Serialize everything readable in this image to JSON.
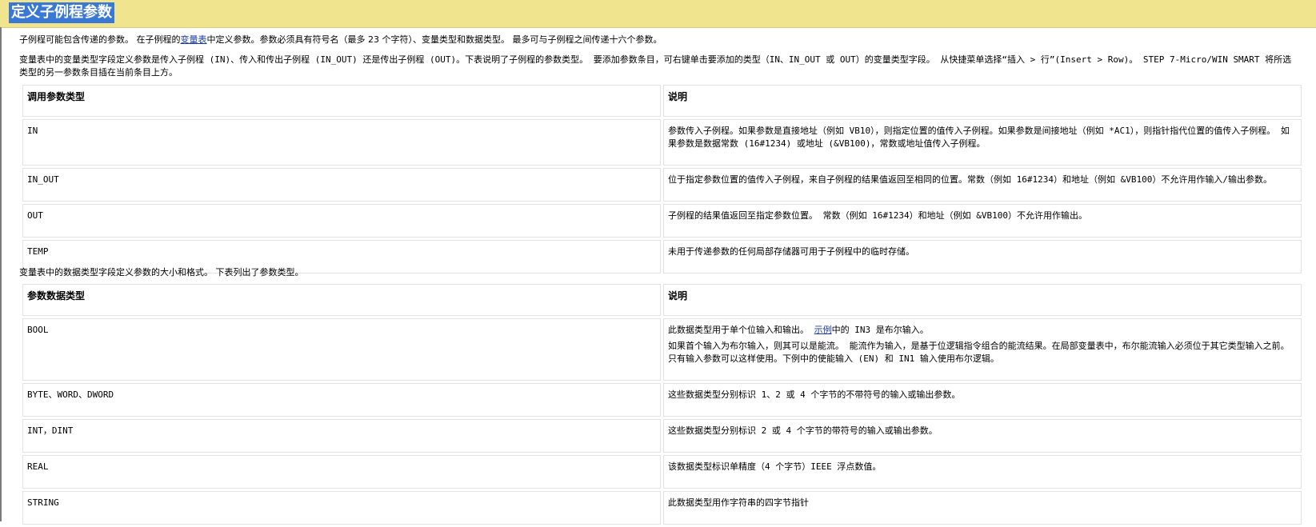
{
  "header": {
    "title": "定义子例程参数"
  },
  "intro": {
    "p1_before": "子例程可能包含传递的参数。 在子例程的",
    "p1_link": "变量表",
    "p1_after": "中定义参数。参数必须具有符号名（最多 23 个字符）、变量类型和数据类型。 最多可与子例程之间传递十六个参数。",
    "p2": "变量表中的变量类型字段定义参数是传入子例程 (IN)、传入和传出子例程 (IN_OUT) 还是传出子例程 (OUT)。下表说明了子例程的参数类型。 要添加参数条目，可右键单击要添加的类型（IN、IN_OUT 或 OUT）的变量类型字段。 从快捷菜单选择“插入 > 行”(Insert > Row)。 STEP 7-Micro/WIN SMART 将所选类型的另一参数条目插在当前条目上方。",
    "p3": "变量表中的数据类型字段定义参数的大小和格式。 下表列出了参数类型。"
  },
  "table1": {
    "headers": [
      "调用参数类型",
      "说明"
    ],
    "rows": [
      {
        "type": "IN",
        "desc": "参数传入子例程。如果参数是直接地址（例如 VB10），则指定位置的值传入子例程。如果参数是间接地址（例如 *AC1），则指针指代位置的值传入子例程。 如果参数是数据常数 (16#1234) 或地址 (&VB100)，常数或地址值传入子例程。"
      },
      {
        "type": "IN_OUT",
        "desc": "位于指定参数位置的值传入子例程，来自子例程的结果值返回至相同的位置。常数（例如 16#1234）和地址（例如 &VB100）不允许用作输入/输出参数。"
      },
      {
        "type": "OUT",
        "desc": "子例程的结果值返回至指定参数位置。 常数（例如 16#1234）和地址（例如 &VB100）不允许用作输出。"
      },
      {
        "type": "TEMP",
        "desc": "未用于传递参数的任何局部存储器可用于子例程中的临时存储。"
      }
    ]
  },
  "table2": {
    "headers": [
      "参数数据类型",
      "说明"
    ],
    "bool": {
      "type": "BOOL",
      "desc1_before": "此数据类型用于单个位输入和输出。 ",
      "desc1_link": "示例",
      "desc1_after": "中的 IN3 是布尔输入。",
      "desc2": "如果首个输入为布尔输入，则其可以是能流。 能流作为输入，是基于位逻辑指令组合的能流结果。在局部变量表中，布尔能流输入必须位于其它类型输入之前。只有输入参数可以这样使用。下例中的使能输入 (EN) 和 IN1 输入使用布尔逻辑。"
    },
    "rows": [
      {
        "type": "BYTE、WORD、DWORD",
        "desc": "这些数据类型分别标识 1、2 或 4 个字节的不带符号的输入或输出参数。"
      },
      {
        "type": "INT，DINT",
        "desc": "这些数据类型分别标识 2 或 4 个字节的带符号的输入或输出参数。"
      },
      {
        "type": "REAL",
        "desc": "该数据类型标识单精度（4 个字节）IEEE 浮点数值。"
      },
      {
        "type": "STRING",
        "desc": "此数据类型用作字符串的四字节指针"
      }
    ]
  }
}
